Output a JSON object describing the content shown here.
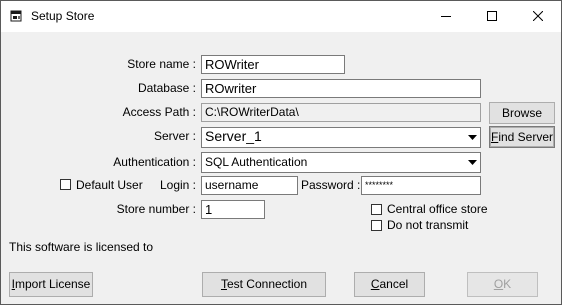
{
  "window": {
    "title": "Setup Store",
    "icon": "store-window-icon",
    "controls": {
      "minimize_icon": "minimize-icon",
      "maximize_icon": "maximize-icon",
      "close_icon": "close-icon"
    }
  },
  "form": {
    "store_name": {
      "label": "Store name :",
      "value": "ROWriter"
    },
    "database": {
      "label": "Database :",
      "value": "ROwriter"
    },
    "access_path": {
      "label": "Access Path :",
      "value": "C:\\ROWriterData\\"
    },
    "server": {
      "label": "Server :",
      "value": "Server_1"
    },
    "authentication": {
      "label": "Authentication :",
      "value": "SQL Authentication"
    },
    "default_user": {
      "label": "Default User",
      "checked": false
    },
    "login": {
      "label": "Login :",
      "value": "username"
    },
    "password": {
      "label": "Password :",
      "value": "********"
    },
    "store_number": {
      "label": "Store number :",
      "value": "1"
    },
    "central_office_store": {
      "label": "Central office store",
      "checked": false
    },
    "do_not_transmit": {
      "label": "Do not transmit",
      "checked": false
    },
    "license_text": "This software is licensed to"
  },
  "buttons": {
    "browse": {
      "pre": "",
      "accel": "",
      "post": "Browse"
    },
    "find_server": {
      "pre": "",
      "accel": "F",
      "post": "ind Server"
    },
    "import_license": {
      "pre": "",
      "accel": "I",
      "post": "mport License"
    },
    "test_connection": {
      "pre": "",
      "accel": "T",
      "post": "est Connection"
    },
    "cancel": {
      "pre": "",
      "accel": "C",
      "post": "ancel"
    },
    "ok": {
      "pre": "",
      "accel": "O",
      "post": "K",
      "enabled": false
    }
  }
}
